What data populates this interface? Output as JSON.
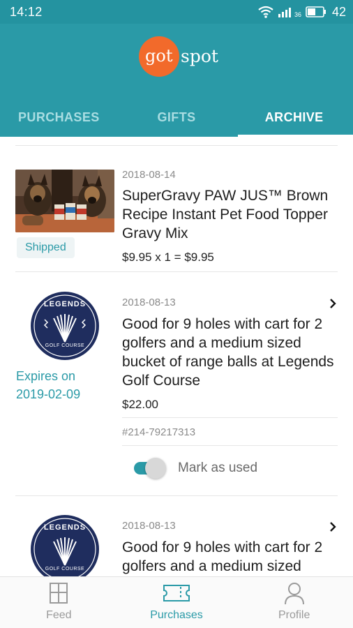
{
  "status_bar": {
    "time": "14:12",
    "network": "36",
    "battery": "42"
  },
  "header": {
    "logo_left": "got",
    "logo_right": "spot"
  },
  "tabs": [
    {
      "label": "PURCHASES",
      "active": false
    },
    {
      "label": "GIFTS",
      "active": false
    },
    {
      "label": "ARCHIVE",
      "active": true
    }
  ],
  "items": [
    {
      "date": "2018-08-14",
      "title": "SuperGravy PAW JUS™ Brown Recipe Instant Pet Food Topper Gravy Mix",
      "price": "$9.95 x 1 = $9.95",
      "status": "Shipped",
      "image": "dogs-with-gravy-cans-photo"
    },
    {
      "date": "2018-08-13",
      "title": "Good for 9 holes with cart for 2 golfers and a medium sized bucket of range balls at Legends Golf Course",
      "price": "$22.00",
      "expires_label": "Expires on",
      "expires_date": "2019-02-09",
      "code": "#214-79217313",
      "mark_used_label": "Mark as used",
      "mark_used": true,
      "logo_text_top": "LEGENDS",
      "logo_text_bottom": "GOLF COURSE"
    },
    {
      "date": "2018-08-13",
      "title": "Good for 9 holes with cart for 2 golfers and a medium sized",
      "logo_text_top": "LEGENDS",
      "logo_text_bottom": "GOLF COURSE"
    }
  ],
  "bottom_nav": [
    {
      "label": "Feed",
      "icon": "feed-icon",
      "active": false
    },
    {
      "label": "Purchases",
      "icon": "ticket-icon",
      "active": true
    },
    {
      "label": "Profile",
      "icon": "person-icon",
      "active": false
    }
  ],
  "colors": {
    "brand_teal": "#2a9aa7",
    "logo_orange": "#f26a2b",
    "legends_navy": "#1f2d5e"
  }
}
